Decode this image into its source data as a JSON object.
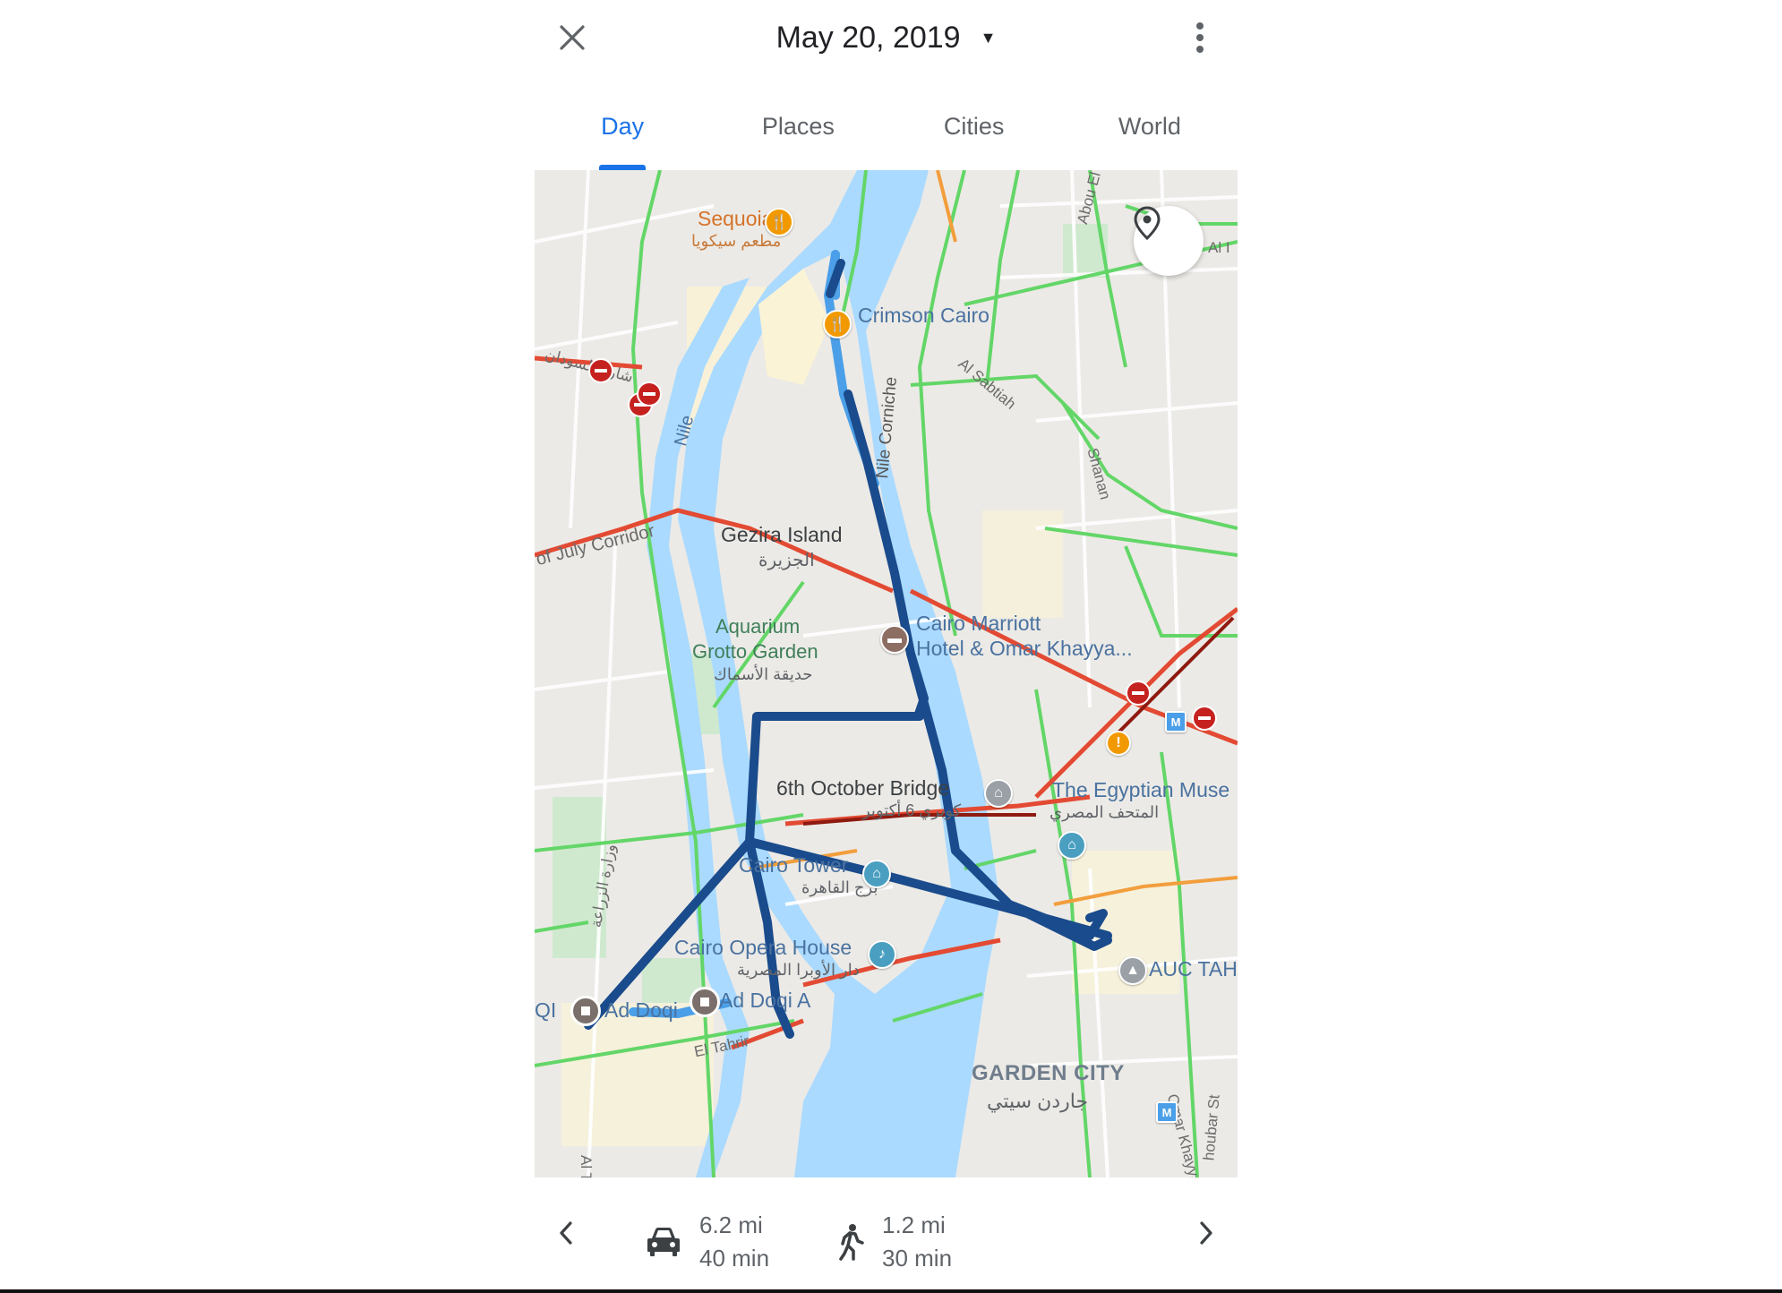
{
  "header": {
    "date": "May 20, 2019",
    "date_caret": "▼"
  },
  "tabs": [
    {
      "label": "Day",
      "active": true
    },
    {
      "label": "Places",
      "active": false
    },
    {
      "label": "Cities",
      "active": false
    },
    {
      "label": "World",
      "active": false
    }
  ],
  "map": {
    "labels": {
      "sequoia": "Sequoia",
      "sequoia_ar": "مطعم سيكويا",
      "crimson": "Crimson Cairo",
      "nile": "Nile",
      "nile_corniche": "Nile Corniche",
      "al_sabtiah": "Al Sabtiah",
      "abou_el": "Abou El",
      "al_edge": "Al I",
      "shanan": "Shanan",
      "july_corridor": "of July Corridor",
      "arabic_street": "شارع السودان",
      "gezira": "Gezira Island",
      "gezira_ar": "الجزيرة",
      "aquarium_1": "Aquarium",
      "aquarium_2": "Grotto Garden",
      "aquarium_ar": "حديقة الأسماك",
      "marriott_1": "Cairo Marriott",
      "marriott_2": "Hotel & Omar Khayya...",
      "bridge": "6th October Bridge",
      "bridge_ar": "كوبري 6 أكتوبر",
      "museum": "The Egyptian Muse",
      "museum_ar": "المتحف المصري",
      "cairo_tower": "Cairo Tower",
      "cairo_tower_ar": "برج القاهرة",
      "opera": "Cairo Opera House",
      "opera_ar": "دار الأوبرا المصرية",
      "auc": "AUC TAH",
      "ad_doqi_a": "Ad Doqi A",
      "ad_doqi": "Ad Doqi",
      "qi": "QI",
      "el_tahrir": "El Tahrir",
      "garden_city": "GARDEN CITY",
      "garden_city_ar": "جاردن سيتي",
      "zeraa": "وزارة الزراعة",
      "hoda": "houbar St",
      "omar_khay": "Omar Khayya",
      "al_bottom": "Al T"
    },
    "icons": {
      "pin": "location-pin-icon",
      "food": "restaurant-icon",
      "hotel": "hotel-icon",
      "museum": "museum-icon",
      "music": "music-icon",
      "school": "school-icon",
      "metro": "metro-icon",
      "alert": "no-entry-icon",
      "warning": "warning-icon"
    },
    "colors": {
      "water": "#aadaff",
      "route_drive": "#1a4b8c",
      "route_walk": "#4a9fe8",
      "traffic_green": "#63d668",
      "traffic_red": "#e34a33"
    }
  },
  "footer": {
    "drive": {
      "distance": "6.2 mi",
      "duration": "40 min"
    },
    "walk": {
      "distance": "1.2 mi",
      "duration": "30 min"
    }
  }
}
